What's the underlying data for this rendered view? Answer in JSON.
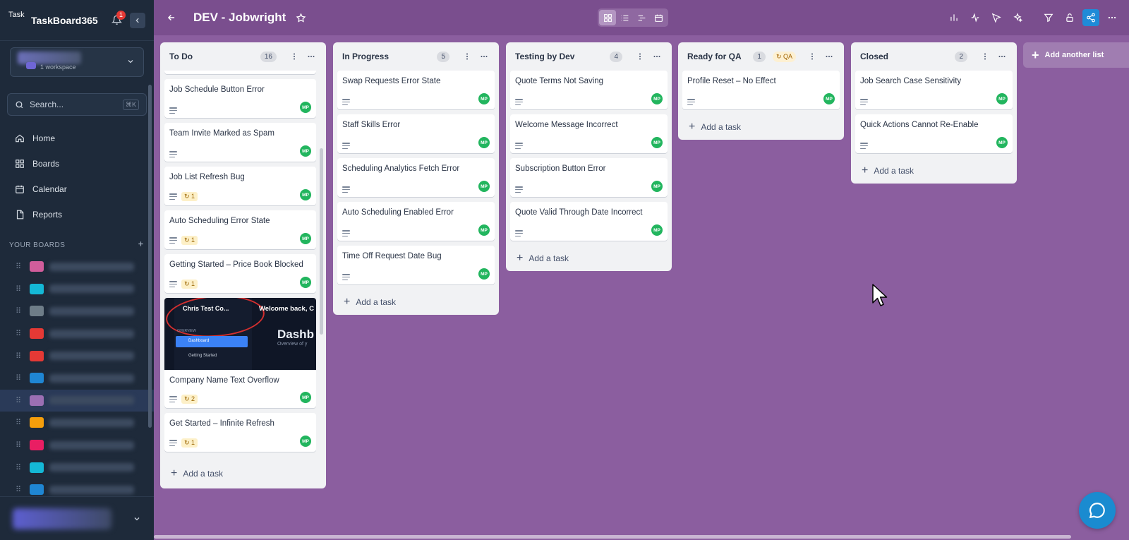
{
  "app": {
    "name": "TaskBoard365",
    "logo_alt": "Task",
    "notification_count": "1"
  },
  "sidebar": {
    "workspace_sub": "1 workspace",
    "search_placeholder": "Search...",
    "search_shortcut": "⌘K",
    "nav": [
      {
        "label": "Home",
        "icon": "home-icon"
      },
      {
        "label": "Boards",
        "icon": "boards-icon"
      },
      {
        "label": "Calendar",
        "icon": "calendar-icon"
      },
      {
        "label": "Reports",
        "icon": "reports-icon"
      }
    ],
    "boards_heading": "YOUR BOARDS",
    "board_colors": [
      "#d15d9b",
      "#14b8d6",
      "#6e7d88",
      "#e53935",
      "#e53935",
      "#1f86d3",
      "#9b6fb3",
      "#f59e0b",
      "#e91e63",
      "#14b8d6",
      "#1f86d3"
    ]
  },
  "header": {
    "title": "DEV - Jobwright"
  },
  "lists": [
    {
      "title": "To Do",
      "count": "16",
      "cards": [
        {
          "title": "Job Schedule Button Error",
          "badge": null
        },
        {
          "title": "Team Invite Marked as Spam",
          "badge": null
        },
        {
          "title": "Job List Refresh Bug",
          "badge": "1"
        },
        {
          "title": "Auto Scheduling Error State",
          "badge": "1"
        },
        {
          "title": "Getting Started – Price Book Blocked",
          "badge": "1"
        },
        {
          "title": "Company Name Text Overflow",
          "badge": "2",
          "has_image": true
        },
        {
          "title": "Get Started – Infinite Refresh",
          "badge": "1"
        }
      ],
      "add_label": "Add a task"
    },
    {
      "title": "In Progress",
      "count": "5",
      "cards": [
        {
          "title": "Swap Requests Error State"
        },
        {
          "title": "Staff Skills Error"
        },
        {
          "title": "Scheduling Analytics Fetch Error"
        },
        {
          "title": "Auto Scheduling Enabled Error"
        },
        {
          "title": "Time Off Request Date Bug"
        }
      ],
      "add_label": "Add a task"
    },
    {
      "title": "Testing by Dev",
      "count": "4",
      "cards": [
        {
          "title": "Quote Terms Not Saving"
        },
        {
          "title": "Welcome Message Incorrect"
        },
        {
          "title": "Subscription Button Error"
        },
        {
          "title": "Quote Valid Through Date Incorrect"
        }
      ],
      "add_label": "Add a task"
    },
    {
      "title": "Ready for QA",
      "count": "1",
      "tag": "QA",
      "cards": [
        {
          "title": "Profile Reset – No Effect"
        }
      ],
      "add_label": "Add a task"
    },
    {
      "title": "Closed",
      "count": "2",
      "cards": [
        {
          "title": "Job Search Case Sensitivity"
        },
        {
          "title": "Quick Actions Cannot Re-Enable"
        }
      ],
      "add_label": "Add a task"
    }
  ],
  "add_list_label": "Add another list",
  "assignee_initials": "MP",
  "cover_image": {
    "workspace": "Chris Test Co...",
    "welcome": "Welcome back, C",
    "dashboard": "Dashb",
    "overview_text": "Overview of y",
    "section": "OVERVIEW",
    "nav_active": "Dashboard",
    "nav_next": "Getting Started"
  },
  "colors": {
    "accent": "#1f8bd8",
    "board_bg": "#8b5e9f",
    "sidebar_bg": "#1e2a3a",
    "avatar": "#22b55e"
  }
}
